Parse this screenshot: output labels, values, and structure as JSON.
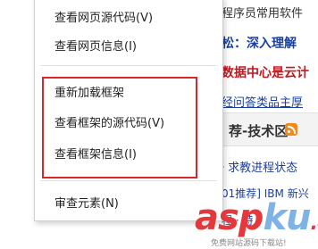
{
  "background": {
    "line1": "程序员常用软件",
    "line2": "松：深入理解",
    "line3": "数据中心是云计",
    "line4": "经问答类品主厚",
    "section_title": "荐-技术区",
    "section_icon": "rss-icon",
    "line5": "求教进程状态",
    "line6": "01推荐] IBM 新兴",
    "line7": "程 · 特"
  },
  "context_menu": {
    "items": [
      {
        "label": "查看网页源代码(V)"
      },
      {
        "label": "查看网页信息(I)"
      },
      {
        "label": "重新加载框架"
      },
      {
        "label": "查看框架的源代码(V)"
      },
      {
        "label": "查看框架信息(I)"
      },
      {
        "label": "审查元素(N)"
      }
    ]
  },
  "highlight_color": "#d9262a",
  "watermark": {
    "brand_a": "asp",
    "brand_b": "ku",
    "brand_c": ".com",
    "subtitle": "免费网站源码下载站!"
  }
}
